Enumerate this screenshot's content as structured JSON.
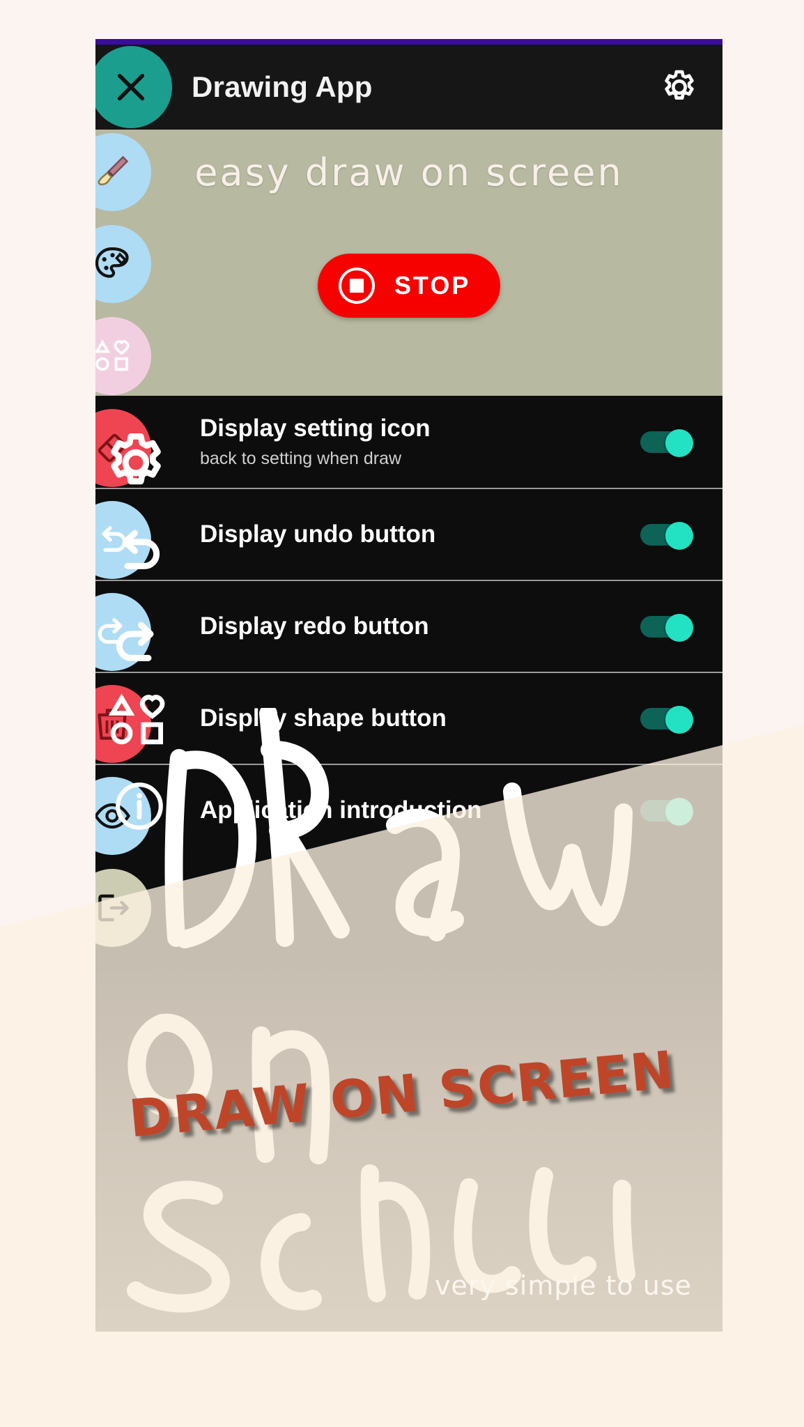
{
  "promo": {
    "headline": "DRAW ON SCREEN",
    "footer_note": "very simple to use",
    "background_color": "#fbf4f0",
    "headline_color": "#bf4529"
  },
  "appbar": {
    "title": "Drawing App",
    "close_icon": "close-x-icon",
    "settings_icon": "gear-icon",
    "close_button_color": "#1c9e8f",
    "background_color": "#161616",
    "status_bar_color": "#3a0ca3"
  },
  "hero": {
    "tagline": "easy draw on screen",
    "background_color": "#b8b9a1",
    "stop_button": {
      "label": "STOP",
      "icon": "stop-square-icon",
      "color": "#f70000"
    }
  },
  "settings": {
    "toggle_on_color": "#22e2c3",
    "toggle_track_color": "#0c6356",
    "rows": [
      {
        "title": "Display setting icon",
        "subtitle": "back to setting when draw",
        "toggle": "on"
      },
      {
        "title": "Display undo button",
        "subtitle": "",
        "toggle": "on"
      },
      {
        "title": "Display redo button",
        "subtitle": "",
        "toggle": "on"
      },
      {
        "title": "Display shape button",
        "subtitle": "",
        "toggle": "on"
      },
      {
        "title": "Application introduction",
        "subtitle": "",
        "toggle": "on"
      }
    ]
  },
  "tool_rail": {
    "items": [
      {
        "name": "brush-tool",
        "icon": "paintbrush-icon",
        "style": "blue"
      },
      {
        "name": "palette-tool",
        "icon": "palette-icon",
        "style": "blue"
      },
      {
        "name": "shape-tool",
        "icon": "shapes-icon",
        "style": "pink"
      },
      {
        "name": "eraser-tool",
        "icon": "eraser-icon",
        "style": "red"
      },
      {
        "name": "undo-tool",
        "icon": "undo-arrow-icon",
        "style": "blue"
      },
      {
        "name": "redo-tool",
        "icon": "redo-arrow-icon",
        "style": "blue"
      },
      {
        "name": "clear-tool",
        "icon": "trash-icon",
        "style": "red"
      },
      {
        "name": "preview-tool",
        "icon": "eye-icon",
        "style": "blue"
      },
      {
        "name": "exit-tool",
        "icon": "exit-icon",
        "style": "khaki"
      }
    ],
    "overlay_icons": [
      {
        "name": "settings-overlay",
        "icon": "gear-outline-icon"
      },
      {
        "name": "undo-overlay",
        "icon": "undo-outline-icon"
      },
      {
        "name": "redo-overlay",
        "icon": "redo-outline-icon"
      },
      {
        "name": "shapes-overlay",
        "icon": "shapes-outline-icon"
      },
      {
        "name": "info-overlay",
        "icon": "info-outline-icon"
      }
    ]
  },
  "canvas": {
    "doodle_text": "DRAW ON SCREEN",
    "stroke_color": "#ffffff"
  }
}
